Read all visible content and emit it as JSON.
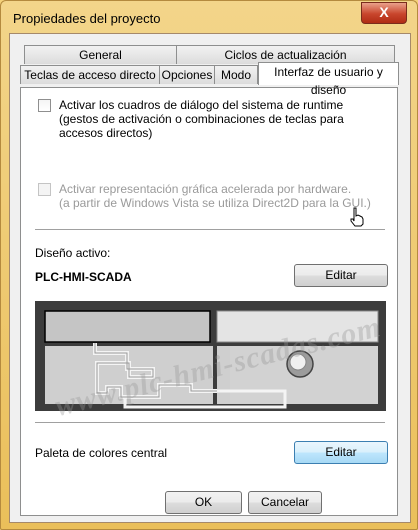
{
  "window": {
    "title": "Propiedades del proyecto",
    "close_label": "X"
  },
  "tabs_row1": [
    {
      "label": "General"
    },
    {
      "label": "Ciclos de actualización"
    }
  ],
  "tabs_row2": [
    {
      "label": "Teclas de acceso directo"
    },
    {
      "label": "Opciones"
    },
    {
      "label": "Modo"
    },
    {
      "label": "Interfaz de usuario y diseño",
      "active": true
    }
  ],
  "options": {
    "dialogs": {
      "checked": false,
      "lines": [
        "Activar los cuadros de diálogo del sistema de runtime",
        "(gestos de activación o combinaciones de teclas para",
        "accesos directos)"
      ]
    },
    "hw_accel": {
      "checked": false,
      "disabled": true,
      "lines": [
        "Activar representación gráfica acelerada por hardware.",
        "(a partir de Windows Vista se utiliza Direct2D para la GUI.)"
      ]
    }
  },
  "design": {
    "label": "Diseño activo:",
    "name": "PLC-HMI-SCADA",
    "edit_label": "Editar"
  },
  "palette": {
    "label": "Paleta de colores central",
    "edit_label": "Editar"
  },
  "footer": {
    "ok_label": "OK",
    "cancel_label": "Cancelar"
  },
  "watermark": "www.plc-hmi-scadas.com",
  "colors": {
    "preview_bg": "#3c3c3c",
    "preview_panel": "#bfbfbf",
    "frame_accent": "#eabf5a"
  }
}
